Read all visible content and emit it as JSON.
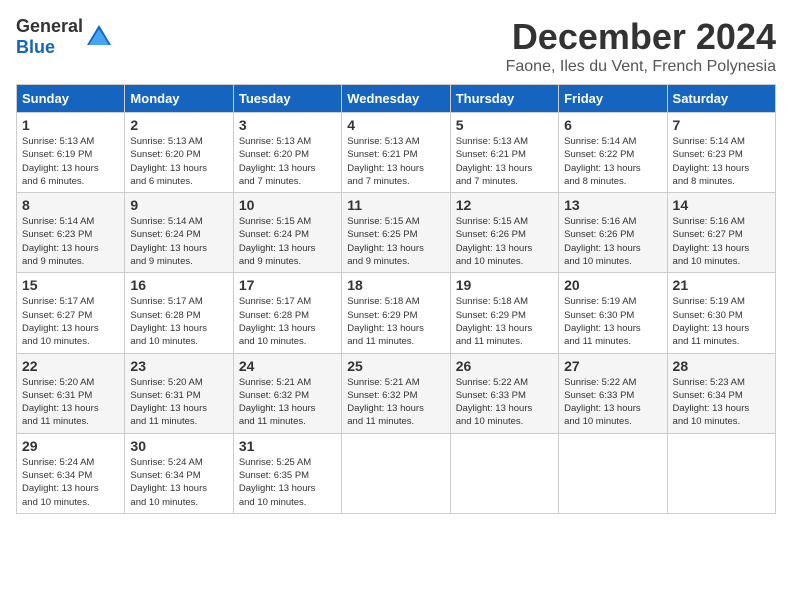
{
  "logo": {
    "general": "General",
    "blue": "Blue"
  },
  "title": "December 2024",
  "location": "Faone, Iles du Vent, French Polynesia",
  "weekdays": [
    "Sunday",
    "Monday",
    "Tuesday",
    "Wednesday",
    "Thursday",
    "Friday",
    "Saturday"
  ],
  "weeks": [
    [
      {
        "day": "1",
        "sunrise": "5:13 AM",
        "sunset": "6:19 PM",
        "daylight": "13 hours and 6 minutes."
      },
      {
        "day": "2",
        "sunrise": "5:13 AM",
        "sunset": "6:20 PM",
        "daylight": "13 hours and 6 minutes."
      },
      {
        "day": "3",
        "sunrise": "5:13 AM",
        "sunset": "6:20 PM",
        "daylight": "13 hours and 7 minutes."
      },
      {
        "day": "4",
        "sunrise": "5:13 AM",
        "sunset": "6:21 PM",
        "daylight": "13 hours and 7 minutes."
      },
      {
        "day": "5",
        "sunrise": "5:13 AM",
        "sunset": "6:21 PM",
        "daylight": "13 hours and 7 minutes."
      },
      {
        "day": "6",
        "sunrise": "5:14 AM",
        "sunset": "6:22 PM",
        "daylight": "13 hours and 8 minutes."
      },
      {
        "day": "7",
        "sunrise": "5:14 AM",
        "sunset": "6:23 PM",
        "daylight": "13 hours and 8 minutes."
      }
    ],
    [
      {
        "day": "8",
        "sunrise": "5:14 AM",
        "sunset": "6:23 PM",
        "daylight": "13 hours and 9 minutes."
      },
      {
        "day": "9",
        "sunrise": "5:14 AM",
        "sunset": "6:24 PM",
        "daylight": "13 hours and 9 minutes."
      },
      {
        "day": "10",
        "sunrise": "5:15 AM",
        "sunset": "6:24 PM",
        "daylight": "13 hours and 9 minutes."
      },
      {
        "day": "11",
        "sunrise": "5:15 AM",
        "sunset": "6:25 PM",
        "daylight": "13 hours and 9 minutes."
      },
      {
        "day": "12",
        "sunrise": "5:15 AM",
        "sunset": "6:26 PM",
        "daylight": "13 hours and 10 minutes."
      },
      {
        "day": "13",
        "sunrise": "5:16 AM",
        "sunset": "6:26 PM",
        "daylight": "13 hours and 10 minutes."
      },
      {
        "day": "14",
        "sunrise": "5:16 AM",
        "sunset": "6:27 PM",
        "daylight": "13 hours and 10 minutes."
      }
    ],
    [
      {
        "day": "15",
        "sunrise": "5:17 AM",
        "sunset": "6:27 PM",
        "daylight": "13 hours and 10 minutes."
      },
      {
        "day": "16",
        "sunrise": "5:17 AM",
        "sunset": "6:28 PM",
        "daylight": "13 hours and 10 minutes."
      },
      {
        "day": "17",
        "sunrise": "5:17 AM",
        "sunset": "6:28 PM",
        "daylight": "13 hours and 10 minutes."
      },
      {
        "day": "18",
        "sunrise": "5:18 AM",
        "sunset": "6:29 PM",
        "daylight": "13 hours and 11 minutes."
      },
      {
        "day": "19",
        "sunrise": "5:18 AM",
        "sunset": "6:29 PM",
        "daylight": "13 hours and 11 minutes."
      },
      {
        "day": "20",
        "sunrise": "5:19 AM",
        "sunset": "6:30 PM",
        "daylight": "13 hours and 11 minutes."
      },
      {
        "day": "21",
        "sunrise": "5:19 AM",
        "sunset": "6:30 PM",
        "daylight": "13 hours and 11 minutes."
      }
    ],
    [
      {
        "day": "22",
        "sunrise": "5:20 AM",
        "sunset": "6:31 PM",
        "daylight": "13 hours and 11 minutes."
      },
      {
        "day": "23",
        "sunrise": "5:20 AM",
        "sunset": "6:31 PM",
        "daylight": "13 hours and 11 minutes."
      },
      {
        "day": "24",
        "sunrise": "5:21 AM",
        "sunset": "6:32 PM",
        "daylight": "13 hours and 11 minutes."
      },
      {
        "day": "25",
        "sunrise": "5:21 AM",
        "sunset": "6:32 PM",
        "daylight": "13 hours and 11 minutes."
      },
      {
        "day": "26",
        "sunrise": "5:22 AM",
        "sunset": "6:33 PM",
        "daylight": "13 hours and 10 minutes."
      },
      {
        "day": "27",
        "sunrise": "5:22 AM",
        "sunset": "6:33 PM",
        "daylight": "13 hours and 10 minutes."
      },
      {
        "day": "28",
        "sunrise": "5:23 AM",
        "sunset": "6:34 PM",
        "daylight": "13 hours and 10 minutes."
      }
    ],
    [
      {
        "day": "29",
        "sunrise": "5:24 AM",
        "sunset": "6:34 PM",
        "daylight": "13 hours and 10 minutes."
      },
      {
        "day": "30",
        "sunrise": "5:24 AM",
        "sunset": "6:34 PM",
        "daylight": "13 hours and 10 minutes."
      },
      {
        "day": "31",
        "sunrise": "5:25 AM",
        "sunset": "6:35 PM",
        "daylight": "13 hours and 10 minutes."
      },
      null,
      null,
      null,
      null
    ]
  ],
  "labels": {
    "sunrise": "Sunrise:",
    "sunset": "Sunset:",
    "daylight": "Daylight:"
  }
}
